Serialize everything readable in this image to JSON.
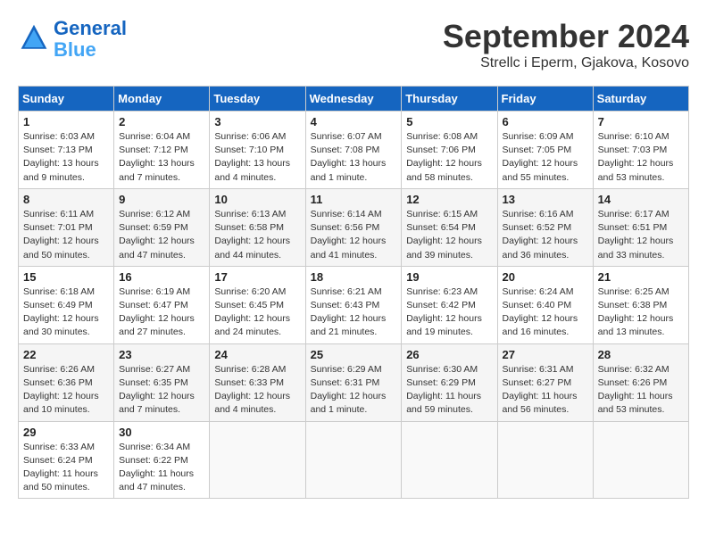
{
  "header": {
    "logo_line1": "General",
    "logo_line2": "Blue",
    "month_title": "September 2024",
    "location": "Strellc i Eperm, Gjakova, Kosovo"
  },
  "days_of_week": [
    "Sunday",
    "Monday",
    "Tuesday",
    "Wednesday",
    "Thursday",
    "Friday",
    "Saturday"
  ],
  "weeks": [
    [
      {
        "day": 1,
        "sunrise": "6:03 AM",
        "sunset": "7:13 PM",
        "daylight": "13 hours and 9 minutes"
      },
      {
        "day": 2,
        "sunrise": "6:04 AM",
        "sunset": "7:12 PM",
        "daylight": "13 hours and 7 minutes"
      },
      {
        "day": 3,
        "sunrise": "6:06 AM",
        "sunset": "7:10 PM",
        "daylight": "13 hours and 4 minutes"
      },
      {
        "day": 4,
        "sunrise": "6:07 AM",
        "sunset": "7:08 PM",
        "daylight": "13 hours and 1 minute"
      },
      {
        "day": 5,
        "sunrise": "6:08 AM",
        "sunset": "7:06 PM",
        "daylight": "12 hours and 58 minutes"
      },
      {
        "day": 6,
        "sunrise": "6:09 AM",
        "sunset": "7:05 PM",
        "daylight": "12 hours and 55 minutes"
      },
      {
        "day": 7,
        "sunrise": "6:10 AM",
        "sunset": "7:03 PM",
        "daylight": "12 hours and 53 minutes"
      }
    ],
    [
      {
        "day": 8,
        "sunrise": "6:11 AM",
        "sunset": "7:01 PM",
        "daylight": "12 hours and 50 minutes"
      },
      {
        "day": 9,
        "sunrise": "6:12 AM",
        "sunset": "6:59 PM",
        "daylight": "12 hours and 47 minutes"
      },
      {
        "day": 10,
        "sunrise": "6:13 AM",
        "sunset": "6:58 PM",
        "daylight": "12 hours and 44 minutes"
      },
      {
        "day": 11,
        "sunrise": "6:14 AM",
        "sunset": "6:56 PM",
        "daylight": "12 hours and 41 minutes"
      },
      {
        "day": 12,
        "sunrise": "6:15 AM",
        "sunset": "6:54 PM",
        "daylight": "12 hours and 39 minutes"
      },
      {
        "day": 13,
        "sunrise": "6:16 AM",
        "sunset": "6:52 PM",
        "daylight": "12 hours and 36 minutes"
      },
      {
        "day": 14,
        "sunrise": "6:17 AM",
        "sunset": "6:51 PM",
        "daylight": "12 hours and 33 minutes"
      }
    ],
    [
      {
        "day": 15,
        "sunrise": "6:18 AM",
        "sunset": "6:49 PM",
        "daylight": "12 hours and 30 minutes"
      },
      {
        "day": 16,
        "sunrise": "6:19 AM",
        "sunset": "6:47 PM",
        "daylight": "12 hours and 27 minutes"
      },
      {
        "day": 17,
        "sunrise": "6:20 AM",
        "sunset": "6:45 PM",
        "daylight": "12 hours and 24 minutes"
      },
      {
        "day": 18,
        "sunrise": "6:21 AM",
        "sunset": "6:43 PM",
        "daylight": "12 hours and 21 minutes"
      },
      {
        "day": 19,
        "sunrise": "6:23 AM",
        "sunset": "6:42 PM",
        "daylight": "12 hours and 19 minutes"
      },
      {
        "day": 20,
        "sunrise": "6:24 AM",
        "sunset": "6:40 PM",
        "daylight": "12 hours and 16 minutes"
      },
      {
        "day": 21,
        "sunrise": "6:25 AM",
        "sunset": "6:38 PM",
        "daylight": "12 hours and 13 minutes"
      }
    ],
    [
      {
        "day": 22,
        "sunrise": "6:26 AM",
        "sunset": "6:36 PM",
        "daylight": "12 hours and 10 minutes"
      },
      {
        "day": 23,
        "sunrise": "6:27 AM",
        "sunset": "6:35 PM",
        "daylight": "12 hours and 7 minutes"
      },
      {
        "day": 24,
        "sunrise": "6:28 AM",
        "sunset": "6:33 PM",
        "daylight": "12 hours and 4 minutes"
      },
      {
        "day": 25,
        "sunrise": "6:29 AM",
        "sunset": "6:31 PM",
        "daylight": "12 hours and 1 minute"
      },
      {
        "day": 26,
        "sunrise": "6:30 AM",
        "sunset": "6:29 PM",
        "daylight": "11 hours and 59 minutes"
      },
      {
        "day": 27,
        "sunrise": "6:31 AM",
        "sunset": "6:27 PM",
        "daylight": "11 hours and 56 minutes"
      },
      {
        "day": 28,
        "sunrise": "6:32 AM",
        "sunset": "6:26 PM",
        "daylight": "11 hours and 53 minutes"
      }
    ],
    [
      {
        "day": 29,
        "sunrise": "6:33 AM",
        "sunset": "6:24 PM",
        "daylight": "11 hours and 50 minutes"
      },
      {
        "day": 30,
        "sunrise": "6:34 AM",
        "sunset": "6:22 PM",
        "daylight": "11 hours and 47 minutes"
      },
      null,
      null,
      null,
      null,
      null
    ]
  ]
}
